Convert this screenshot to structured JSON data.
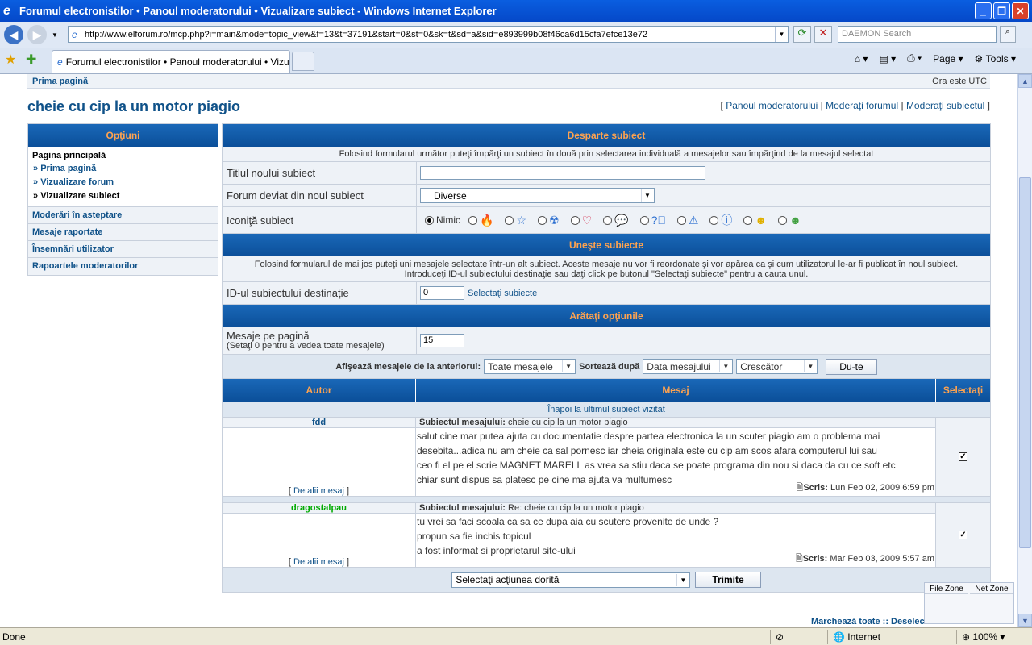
{
  "window": {
    "title": "Forumul electronistilor • Panoul moderatorului • Vizualizare subiect - Windows Internet Explorer"
  },
  "browser": {
    "url": "http://www.elforum.ro/mcp.php?i=main&mode=topic_view&f=13&t=37191&start=0&st=0&sk=t&sd=a&sid=e893999b08f46ca6d15cfa7efce13e72",
    "search_placeholder": "DAEMON Search",
    "tab_label": "Forumul electronistilor • Panoul moderatorului • Vizuali...",
    "page_label": "Page",
    "tools_label": "Tools",
    "status": "Done",
    "zone": "Internet",
    "zoom": "100%"
  },
  "page": {
    "breadcrumb": "Prima pagină",
    "timezone": "Ora este UTC",
    "title": "cheie cu cip la un motor piagio",
    "modlinks": {
      "panel": "Panoul moderatorului",
      "forum": "Moderaţi forumul",
      "topic": "Moderaţi subiectul"
    }
  },
  "sidebar": {
    "header": "Opţiuni",
    "main_heading": "Pagina principală",
    "main_items": [
      "Prima pagină",
      "Vizualizare forum",
      "Vizualizare subiect"
    ],
    "items": [
      "Moderări în asteptare",
      "Mesaje raportate",
      "Însemnări utilizator",
      "Rapoartele moderatorilor"
    ]
  },
  "split": {
    "header": "Desparte subiect",
    "desc": "Folosind formularul următor puteţi împărţi un subiect în două prin selectarea individuală a mesajelor sau împărţind de la mesajul selectat",
    "title_label": "Titlul noului subiect",
    "title_value": "",
    "forum_label": "Forum deviat din noul subiect",
    "forum_value": "Diverse",
    "icon_label": "Iconiţă subiect",
    "icon_none": "Nimic"
  },
  "merge": {
    "header": "Uneşte subiecte",
    "desc1": "Folosind formularul de mai jos puteţi uni mesajele selectate într-un alt subiect. Aceste mesaje nu vor fi reordonate şi vor apărea ca şi cum utilizatorul le-ar fi publicat în noul subiect.",
    "desc2": "Introduceţi ID-ul subiectului destinaţie sau daţi click pe butonul \"Selectaţi subiecte\" pentru a cauta unul.",
    "id_label": "ID-ul subiectului destinaţie",
    "id_value": "0",
    "select_link": "Selectaţi subiecte"
  },
  "options": {
    "header": "Arătaţi opţiunile",
    "perpage_label": "Mesaje pe pagină",
    "perpage_hint": "(Setaţi 0 pentru a vedea toate mesajele)",
    "perpage_value": "15",
    "show_label": "Afişează mesajele de la anteriorul:",
    "show_value": "Toate mesajele",
    "sort_label": "Sortează după",
    "sort_value": "Data mesajului",
    "order_value": "Crescător",
    "go_label": "Du-te"
  },
  "table": {
    "col_author": "Autor",
    "col_message": "Mesaj",
    "col_select": "Selectaţi",
    "back_link": "Înapoi la ultimul subiect vizitat",
    "subject_label": "Subiectul mesajului:",
    "details_label": "Detalii mesaj",
    "posted_label": "Scris:"
  },
  "posts": [
    {
      "author": "fdd",
      "author_color": "#105289",
      "subject": "cheie cu cip la un motor piagio",
      "lines": [
        "salut cine mar putea ajuta cu documentatie despre partea electronica la un scuter piagio am o problema mai",
        "desebita...adica nu am cheie ca sal pornesc iar cheia originala este cu cip am scos afara computerul lui sau",
        "ceo fi el pe el scrie MAGNET MARELL as vrea sa stiu daca se poate programa din nou si daca da cu ce soft etc",
        "chiar sunt dispus sa platesc pe cine ma ajuta va multumesc"
      ],
      "date": "Lun Feb 02, 2009 6:59 pm",
      "checked": true
    },
    {
      "author": "dragostalpau",
      "author_color": "#00aa00",
      "subject": "Re: cheie cu cip la un motor piagio",
      "lines": [
        "tu vrei sa faci scoala ca sa ce dupa aia cu scutere provenite de unde ?",
        "propun sa fie inchis topicul",
        "a fost informat si proprietarul site-ului"
      ],
      "date": "Mar Feb 03, 2009 5:57 am",
      "checked": true
    }
  ],
  "actions": {
    "select_value": "Selectaţi acţiunea dorită",
    "submit_label": "Trimite",
    "mark_all": "Marchează toate",
    "sep": "::",
    "unmark_all": "Deselectează toate"
  },
  "netmon": {
    "file_zone": "File Zone",
    "net_zone": "Net Zone"
  }
}
